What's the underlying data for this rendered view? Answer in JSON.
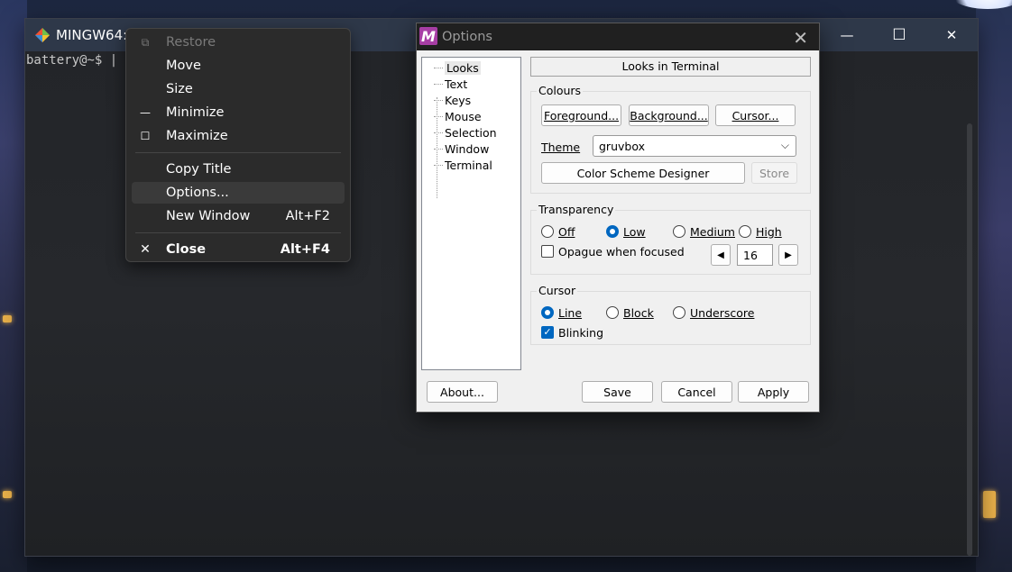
{
  "terminal": {
    "title": "MINGW64:/",
    "prompt": "battery@~$ |"
  },
  "window_controls": {
    "minimize": "—",
    "maximize": "☐",
    "close": "✕"
  },
  "context_menu": {
    "items": [
      {
        "label": "Restore",
        "icon": "restore-icon",
        "glyph": "⧉",
        "shortcut": "",
        "disabled": true
      },
      {
        "label": "Move",
        "icon": "",
        "glyph": "",
        "shortcut": ""
      },
      {
        "label": "Size",
        "icon": "",
        "glyph": "",
        "shortcut": ""
      },
      {
        "label": "Minimize",
        "icon": "minimize-icon",
        "glyph": "—",
        "shortcut": ""
      },
      {
        "label": "Maximize",
        "icon": "maximize-icon",
        "glyph": "☐",
        "shortcut": ""
      },
      {
        "label": "Copy Title",
        "icon": "",
        "glyph": "",
        "shortcut": ""
      },
      {
        "label": "Options...",
        "icon": "",
        "glyph": "",
        "shortcut": "",
        "hover": true
      },
      {
        "label": "New Window",
        "icon": "",
        "glyph": "",
        "shortcut": "Alt+F2"
      },
      {
        "label": "Close",
        "icon": "close-icon",
        "glyph": "✕",
        "shortcut": "Alt+F4",
        "bold": true
      }
    ]
  },
  "dialog": {
    "icon_letter": "M",
    "title": "Options",
    "close_glyph": "✕",
    "tree": [
      "Looks",
      "Text",
      "Keys",
      "Mouse",
      "Selection",
      "Window",
      "Terminal"
    ],
    "selected_tree_item": "Looks",
    "header": "Looks in Terminal",
    "colours": {
      "label": "Colours",
      "foreground": "Foreground...",
      "background": "Background...",
      "cursor": "Cursor...",
      "theme_label": "Theme",
      "theme_value": "gruvbox",
      "scheme_designer": "Color Scheme Designer",
      "store": "Store"
    },
    "transparency": {
      "label": "Transparency",
      "options": [
        "Off",
        "Low",
        "Medium",
        "High"
      ],
      "selected": "Low",
      "opaque_label": "Opague when focused",
      "opaque_checked": false,
      "level_value": "16",
      "dec_glyph": "◀",
      "inc_glyph": "▶"
    },
    "cursor": {
      "label": "Cursor",
      "options": [
        "Line",
        "Block",
        "Underscore"
      ],
      "selected": "Line",
      "blinking_label": "Blinking",
      "blinking_checked": true
    },
    "buttons": {
      "about": "About...",
      "save": "Save",
      "cancel": "Cancel",
      "apply": "Apply"
    }
  },
  "colors": {
    "accent": "#0067c0",
    "mintty_icon": "#a73ea5",
    "titlebar": "#2e3849",
    "menu_bg": "#2b2b2b"
  }
}
